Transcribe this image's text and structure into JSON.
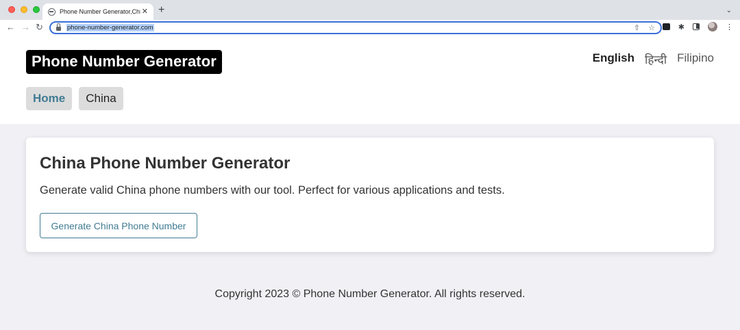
{
  "browser": {
    "tab_title": "Phone Number Generator,China",
    "tab_close": "✕",
    "new_tab": "+",
    "tab_menu": "⌄",
    "url": "phone-number-generator.com",
    "nav_icons": {
      "back": "←",
      "forward": "→",
      "reload": "↻"
    },
    "omnibox_icons": {
      "share": "⇧",
      "bookmark": "☆"
    },
    "toolbar_icons": [
      "extension-box-icon",
      "puzzle-icon",
      "side-panel-icon",
      "profile-avatar",
      "kebab-menu-icon"
    ],
    "toolbar_glyphs": {
      "puzzle": "✱",
      "menu": "⋮"
    }
  },
  "header": {
    "logo": "Phone Number Generator",
    "languages": [
      {
        "label": "English",
        "active": true
      },
      {
        "label": "हिन्दी",
        "active": false
      },
      {
        "label": "Filipino",
        "active": false
      }
    ]
  },
  "nav": {
    "items": [
      {
        "label": "Home",
        "active": true
      },
      {
        "label": "China",
        "active": false
      }
    ]
  },
  "card": {
    "title": "China Phone Number Generator",
    "description": "Generate valid China phone numbers with our tool. Perfect for various applications and tests.",
    "button_label": "Generate China Phone Number"
  },
  "footer": {
    "copyright": "Copyright 2023 © Phone Number Generator. All rights reserved."
  },
  "colors": {
    "accent": "#417b93",
    "page_bg": "#f0f0f5",
    "logo_bg": "#000000"
  }
}
